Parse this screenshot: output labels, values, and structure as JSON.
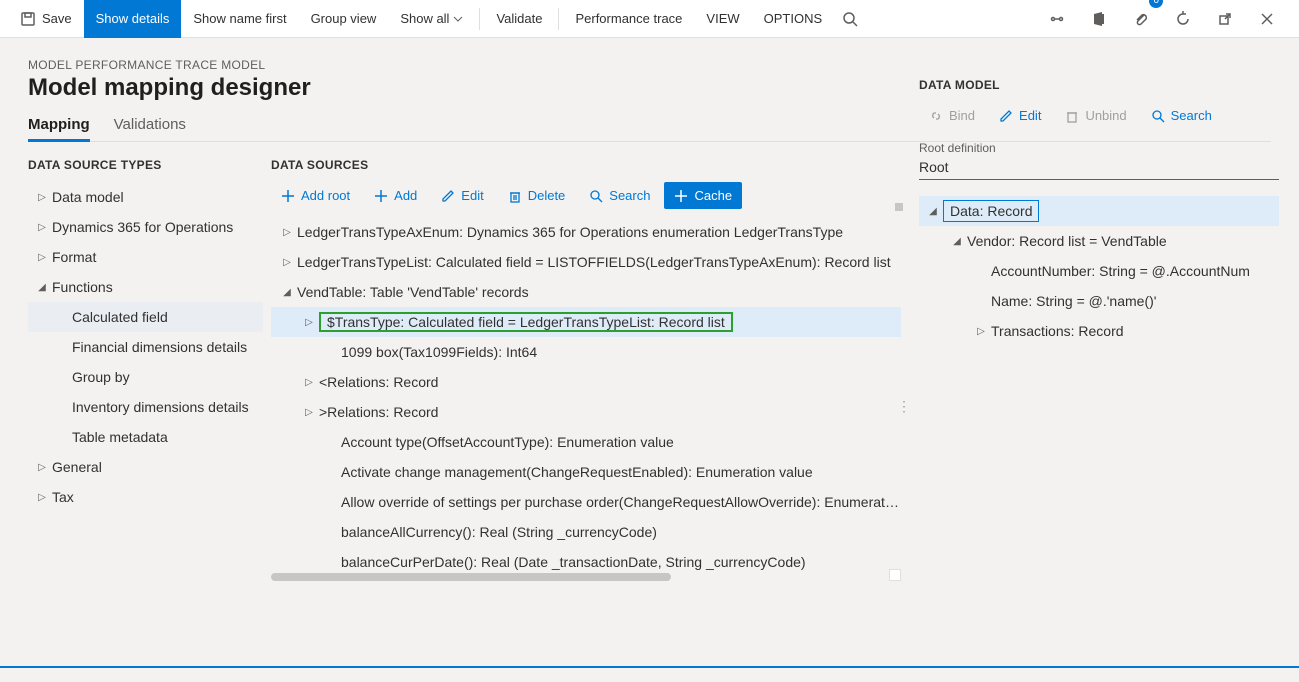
{
  "topbar": {
    "save": "Save",
    "show_details": "Show details",
    "show_name_first": "Show name first",
    "group_view": "Group view",
    "show_all": "Show all",
    "validate": "Validate",
    "perf_trace": "Performance trace",
    "view": "VIEW",
    "options": "OPTIONS",
    "badge_count": "0"
  },
  "header": {
    "breadcrumb": "MODEL PERFORMANCE TRACE MODEL",
    "title": "Model mapping designer"
  },
  "tabs": {
    "mapping": "Mapping",
    "validations": "Validations"
  },
  "left": {
    "title": "DATA SOURCE TYPES",
    "items": [
      "Data model",
      "Dynamics 365 for Operations",
      "Format",
      "Functions",
      "General",
      "Tax"
    ],
    "func_children": [
      "Calculated field",
      "Financial dimensions details",
      "Group by",
      "Inventory dimensions details",
      "Table metadata"
    ]
  },
  "mid": {
    "title": "DATA SOURCES",
    "actions": {
      "add_root": "Add root",
      "add": "Add",
      "edit": "Edit",
      "delete": "Delete",
      "search": "Search",
      "cache": "Cache"
    },
    "items": [
      "LedgerTransTypeAxEnum: Dynamics 365 for Operations enumeration LedgerTransType",
      "LedgerTransTypeList: Calculated field = LISTOFFIELDS(LedgerTransTypeAxEnum): Record list",
      "VendTable: Table 'VendTable' records",
      "$TransType: Calculated field = LedgerTransTypeList: Record list",
      "1099 box(Tax1099Fields): Int64",
      "<Relations: Record",
      ">Relations: Record",
      "Account type(OffsetAccountType): Enumeration value",
      "Activate change management(ChangeRequestEnabled): Enumeration value",
      "Allow override of settings per purchase order(ChangeRequestAllowOverride): Enumeration value",
      "balanceAllCurrency(): Real (String _currencyCode)",
      "balanceCurPerDate(): Real (Date _transactionDate, String _currencyCode)"
    ]
  },
  "right": {
    "title": "DATA MODEL",
    "actions": {
      "bind": "Bind",
      "edit": "Edit",
      "unbind": "Unbind",
      "search": "Search"
    },
    "root_def_label": "Root definition",
    "root_def": "Root",
    "items": [
      "Data: Record",
      "Vendor: Record list = VendTable",
      "AccountNumber: String = @.AccountNum",
      "Name: String = @.'name()'",
      "Transactions: Record"
    ]
  }
}
